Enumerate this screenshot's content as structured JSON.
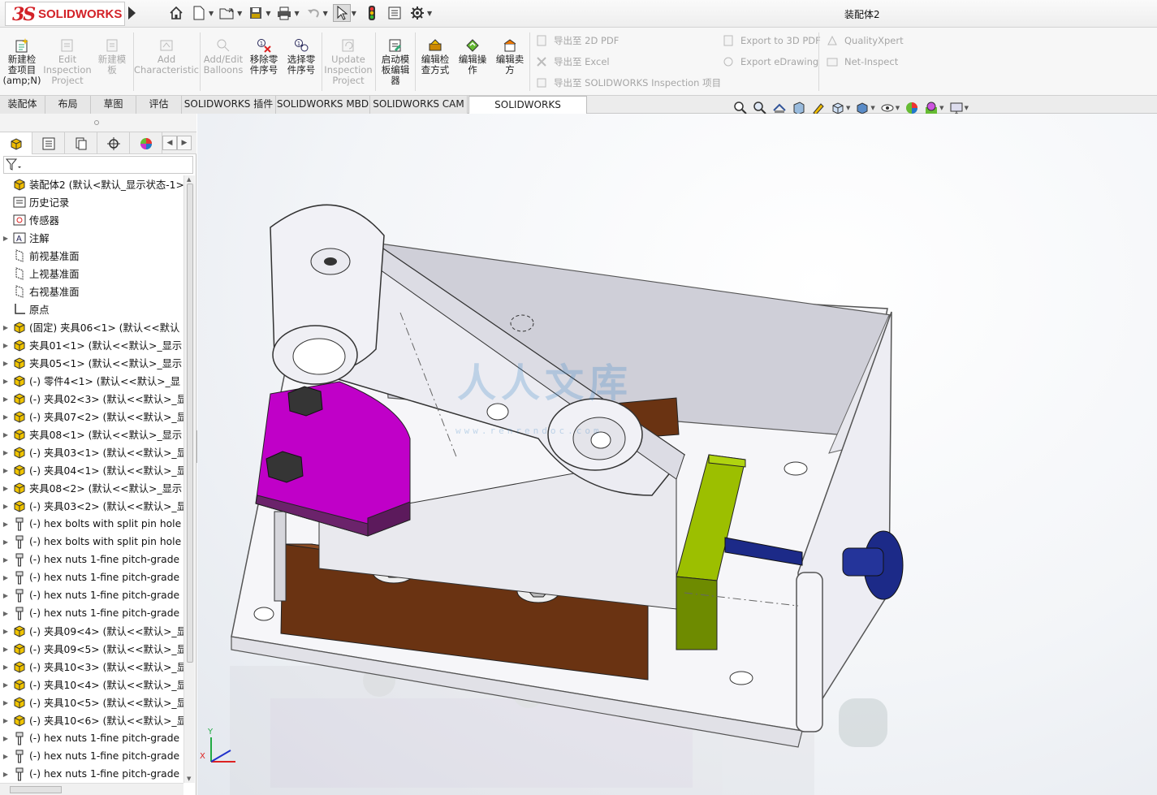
{
  "app": {
    "logo_ds": "3S",
    "logo_text": "SOLIDWORKS",
    "document_title": "装配体2"
  },
  "quick_access": [
    "home-icon",
    "new-icon",
    "open-icon",
    "save-icon",
    "print-icon",
    "undo-icon",
    "select-icon",
    "rebuild-icon",
    "file-properties-icon",
    "options-icon"
  ],
  "ribbon": {
    "buttons": [
      {
        "id": "new-inspection-project",
        "label": "新建检\n查项目\n(amp;N)",
        "enabled": true
      },
      {
        "id": "edit-inspection-project",
        "label": "Edit\nInspection\nProject",
        "enabled": false
      },
      {
        "id": "new-template",
        "label": "新建模\n板",
        "enabled": false
      },
      {
        "id": "add-characteristic",
        "label": "Add\nCharacteristic",
        "enabled": false
      },
      {
        "id": "add-edit-balloons",
        "label": "Add/Edit\nBalloons",
        "enabled": false
      },
      {
        "id": "remove-part-number",
        "label": "移除零\n件序号",
        "enabled": true
      },
      {
        "id": "select-part-number",
        "label": "选择零\n件序号",
        "enabled": true
      },
      {
        "id": "update-inspection-project",
        "label": "Update\nInspection\nProject",
        "enabled": false
      },
      {
        "id": "launch-template-editor",
        "label": "启动模\n板编辑\n器",
        "enabled": true
      },
      {
        "id": "edit-inspection-method",
        "label": "编辑检\n查方式",
        "enabled": true
      },
      {
        "id": "edit-operation",
        "label": "编辑操\n作",
        "enabled": true
      },
      {
        "id": "edit-vendor",
        "label": "编辑卖\n方",
        "enabled": true
      }
    ],
    "export_col1": [
      "导出至 2D PDF",
      "导出至 Excel",
      "导出至 SOLIDWORKS Inspection 项目"
    ],
    "export_col2": [
      "Export to 3D PDF",
      "Export eDrawing"
    ],
    "export_col3": [
      "QualityXpert",
      "Net-Inspect"
    ]
  },
  "tabs": [
    "装配体",
    "布局",
    "草图",
    "评估",
    "SOLIDWORKS 插件",
    "SOLIDWORKS MBD",
    "SOLIDWORKS CAM",
    "SOLIDWORKS Inspection"
  ],
  "active_tab": "SOLIDWORKS Inspection",
  "tree": [
    {
      "icon": "assembly",
      "expander": "",
      "label": "装配体2  (默认<默认_显示状态-1>)"
    },
    {
      "icon": "history",
      "expander": "",
      "label": "历史记录"
    },
    {
      "icon": "sensor",
      "expander": "",
      "label": "传感器"
    },
    {
      "icon": "annotation",
      "expander": "▶",
      "label": "注解"
    },
    {
      "icon": "plane",
      "expander": "",
      "label": "前视基准面"
    },
    {
      "icon": "plane",
      "expander": "",
      "label": "上视基准面"
    },
    {
      "icon": "plane",
      "expander": "",
      "label": "右视基准面"
    },
    {
      "icon": "origin",
      "expander": "",
      "label": "原点"
    },
    {
      "icon": "part",
      "expander": "▶",
      "label": "(固定) 夹具06<1> (默认<<默认"
    },
    {
      "icon": "part",
      "expander": "▶",
      "label": "夹具01<1> (默认<<默认>_显示"
    },
    {
      "icon": "part",
      "expander": "▶",
      "label": "夹具05<1> (默认<<默认>_显示"
    },
    {
      "icon": "part",
      "expander": "▶",
      "label": "(-) 零件4<1> (默认<<默认>_显"
    },
    {
      "icon": "part",
      "expander": "▶",
      "label": "(-) 夹具02<3> (默认<<默认>_显"
    },
    {
      "icon": "part",
      "expander": "▶",
      "label": "(-) 夹具07<2> (默认<<默认>_显"
    },
    {
      "icon": "part",
      "expander": "▶",
      "label": "夹具08<1> (默认<<默认>_显示"
    },
    {
      "icon": "part",
      "expander": "▶",
      "label": "(-) 夹具03<1> (默认<<默认>_显"
    },
    {
      "icon": "part",
      "expander": "▶",
      "label": "(-) 夹具04<1> (默认<<默认>_显"
    },
    {
      "icon": "part",
      "expander": "▶",
      "label": "夹具08<2> (默认<<默认>_显示"
    },
    {
      "icon": "part",
      "expander": "▶",
      "label": "(-) 夹具03<2> (默认<<默认>_显"
    },
    {
      "icon": "toolbox",
      "expander": "▶",
      "label": "(-) hex bolts with split pin hole"
    },
    {
      "icon": "toolbox",
      "expander": "▶",
      "label": "(-) hex bolts with split pin hole"
    },
    {
      "icon": "toolbox",
      "expander": "▶",
      "label": "(-) hex nuts 1-fine pitch-grade"
    },
    {
      "icon": "toolbox",
      "expander": "▶",
      "label": "(-) hex nuts 1-fine pitch-grade"
    },
    {
      "icon": "toolbox",
      "expander": "▶",
      "label": "(-) hex nuts 1-fine pitch-grade"
    },
    {
      "icon": "toolbox",
      "expander": "▶",
      "label": "(-) hex nuts 1-fine pitch-grade"
    },
    {
      "icon": "part",
      "expander": "▶",
      "label": "(-) 夹具09<4> (默认<<默认>_显"
    },
    {
      "icon": "part",
      "expander": "▶",
      "label": "(-) 夹具09<5> (默认<<默认>_显"
    },
    {
      "icon": "part",
      "expander": "▶",
      "label": "(-) 夹具10<3> (默认<<默认>_显"
    },
    {
      "icon": "part",
      "expander": "▶",
      "label": "(-) 夹具10<4> (默认<<默认>_显"
    },
    {
      "icon": "part",
      "expander": "▶",
      "label": "(-) 夹具10<5> (默认<<默认>_显"
    },
    {
      "icon": "part",
      "expander": "▶",
      "label": "(-) 夹具10<6> (默认<<默认>_显"
    },
    {
      "icon": "toolbox",
      "expander": "▶",
      "label": "(-) hex nuts 1-fine pitch-grade"
    },
    {
      "icon": "toolbox",
      "expander": "▶",
      "label": "(-) hex nuts 1-fine pitch-grade"
    },
    {
      "icon": "toolbox",
      "expander": "▶",
      "label": "(-) hex nuts 1-fine pitch-grade"
    }
  ],
  "viewport": {
    "watermark": "人人文库",
    "watermark_url": "www.renrendoc.com",
    "triad_x": "X",
    "triad_y": "Y"
  },
  "colors": {
    "accent_red": "#d32228",
    "magenta_part": "#c000c8",
    "brown_part": "#6a3312",
    "green_part": "#8ab000",
    "blue_part": "#1c2a88",
    "enclosure": "#f4f4f8"
  }
}
